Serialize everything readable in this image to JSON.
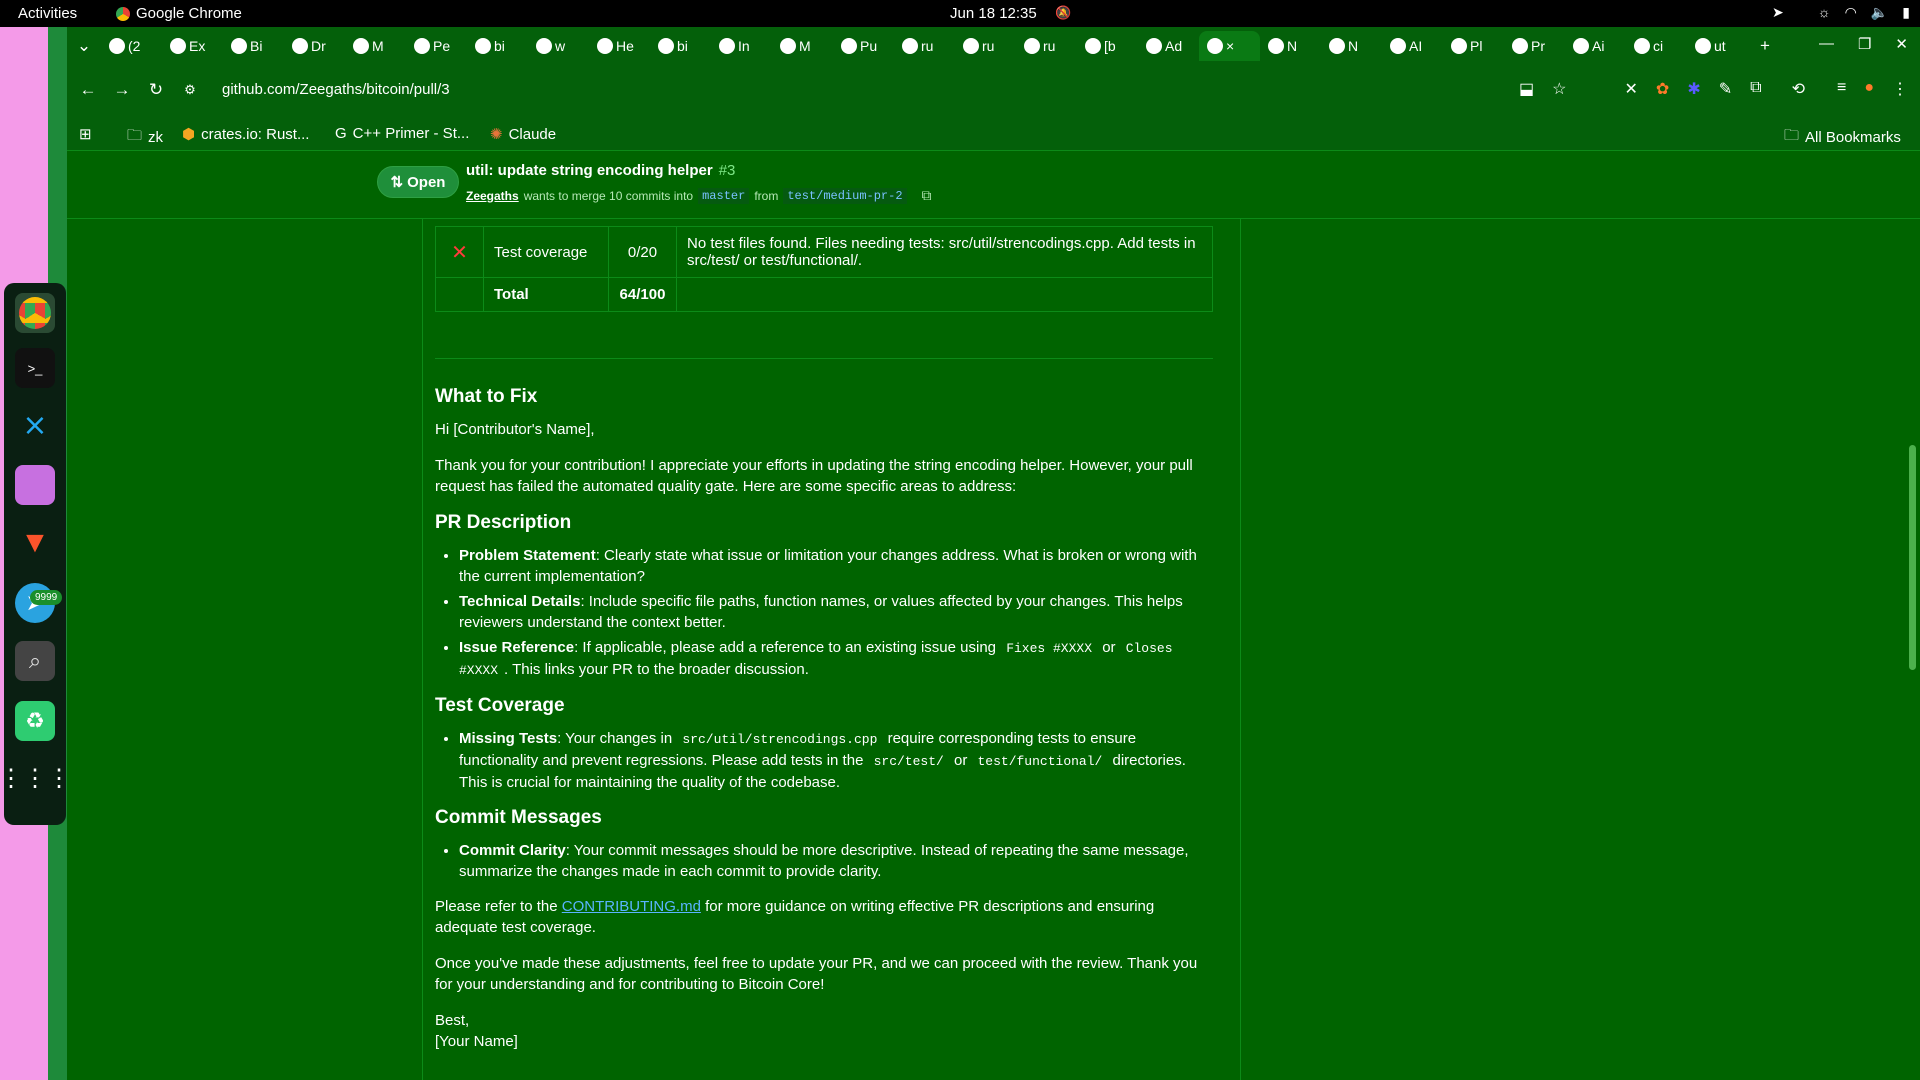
{
  "topbar": {
    "activities": "Activities",
    "app": "Google Chrome",
    "clock": "Jun 18  12:35"
  },
  "dock": {
    "badge": "9999"
  },
  "tabs": [
    {
      "icon": "whatsapp-icon",
      "label": "(2"
    },
    {
      "icon": "drive-icon",
      "label": "Ex"
    },
    {
      "icon": "d-icon",
      "label": "Bi"
    },
    {
      "icon": "d-icon",
      "label": "Dr"
    },
    {
      "icon": "d-icon",
      "label": "M"
    },
    {
      "icon": "github-icon",
      "label": "Pe"
    },
    {
      "icon": "github-icon",
      "label": "bi"
    },
    {
      "icon": "gemini-icon",
      "label": "w"
    },
    {
      "icon": "drive-icon",
      "label": "He"
    },
    {
      "icon": "sheets-icon",
      "label": "bi"
    },
    {
      "icon": "gmail-icon",
      "label": "In"
    },
    {
      "icon": "github-icon",
      "label": "M"
    },
    {
      "icon": "github-icon",
      "label": "Pu"
    },
    {
      "icon": "github-icon",
      "label": "ru"
    },
    {
      "icon": "github-icon",
      "label": "ru"
    },
    {
      "icon": "github-icon",
      "label": "ru"
    },
    {
      "icon": "github-icon",
      "label": "[b"
    },
    {
      "icon": "github-icon",
      "label": "Ad"
    },
    {
      "icon": "github-icon",
      "label": "×",
      "active": true
    },
    {
      "icon": "openai-icon",
      "label": "N"
    },
    {
      "icon": "openai-icon",
      "label": "N"
    },
    {
      "icon": "ai-icon",
      "label": "AI"
    },
    {
      "icon": "perplexity-icon",
      "label": "Pl"
    },
    {
      "icon": "perplexity-icon",
      "label": "Pr"
    },
    {
      "icon": "ai-icon",
      "label": "Ai"
    },
    {
      "icon": "github-icon",
      "label": "ci"
    },
    {
      "icon": "github-icon",
      "label": "ut"
    }
  ],
  "toolbar": {
    "url": "github.com/Zeegaths/bitcoin/pull/3"
  },
  "bookmarks": {
    "b1": "zk",
    "b2": "crates.io: Rust...",
    "b3": "C++ Primer - St...",
    "b4": "Claude",
    "all": "All Bookmarks"
  },
  "pr": {
    "state": "Open",
    "title": "util: update string encoding helper",
    "number": "#3",
    "author": "Zeegaths",
    "merge_text": "wants to merge 10 commits into",
    "base": "master",
    "from": "from",
    "head": "test/medium-pr-2"
  },
  "score_table": {
    "row1": {
      "name": "Test coverage",
      "score": "0/20",
      "detail": "No test files found. Files needing tests: src/util/strencodings.cpp. Add tests in src/test/ or test/functional/."
    },
    "total": {
      "name": "Total",
      "score": "64/100"
    }
  },
  "body": {
    "h_fix": "What to Fix",
    "greeting": "Hi [Contributor's Name],",
    "intro": "Thank you for your contribution! I appreciate your efforts in updating the string encoding helper. However, your pull request has failed the automated quality gate. Here are some specific areas to address:",
    "h_desc": "PR Description",
    "d1_label": "Problem Statement",
    "d1_text": ": Clearly state what issue or limitation your changes address. What is broken or wrong with the current implementation?",
    "d2_label": "Technical Details",
    "d2_text": ": Include specific file paths, function names, or values affected by your changes. This helps reviewers understand the context better.",
    "d3_label": "Issue Reference",
    "d3_a": ": If applicable, please add a reference to an existing issue using",
    "d3_code1": "Fixes #XXXX",
    "d3_or": "or",
    "d3_code2": "Closes #XXXX",
    "d3_b": ". This links your PR to the broader discussion.",
    "h_test": "Test Coverage",
    "t1_label": "Missing Tests",
    "t1_a": ": Your changes in",
    "t1_code1": "src/util/strencodings.cpp",
    "t1_b": "require corresponding tests to ensure functionality and prevent regressions. Please add tests in the",
    "t1_code2": "src/test/",
    "t1_or": "or",
    "t1_code3": "test/functional/",
    "t1_c": "directories. This is crucial for maintaining the quality of the codebase.",
    "h_commit": "Commit Messages",
    "c1_label": "Commit Clarity",
    "c1_text": ": Your commit messages should be more descriptive. Instead of repeating the same message, summarize the changes made in each commit to provide clarity.",
    "refer_a": "Please refer to the",
    "refer_link": "CONTRIBUTING.md",
    "refer_b": "for more guidance on writing effective PR descriptions and ensuring adequate test coverage.",
    "closing": "Once you've made these adjustments, feel free to update your PR, and we can proceed with the review. Thank you for your understanding and for contributing to Bitcoin Core!",
    "signoff": "Best,",
    "name": "[Your Name]"
  },
  "colors": {
    "page_bg": "#006400",
    "dock_pink": "#f49ae8",
    "open_green": "#1f8f3a",
    "link": "#5ab4ff",
    "fail": "#ff3b3b"
  }
}
